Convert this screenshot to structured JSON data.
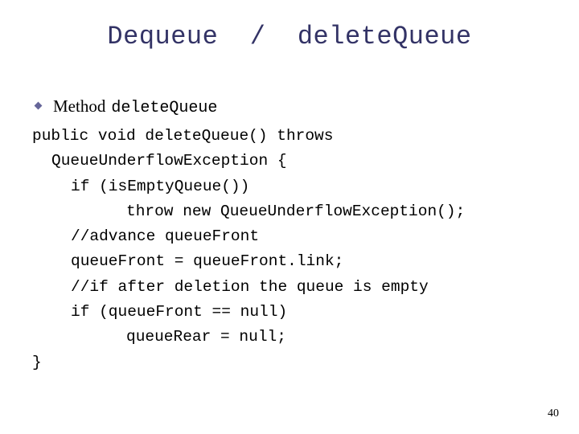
{
  "slide": {
    "title": "Dequeue  /  deleteQueue",
    "page_number": "40",
    "bullet": {
      "icon": "diamond-bullet-icon",
      "serif_text": "Method",
      "mono_text": "deleteQueue"
    },
    "code": {
      "lines": [
        {
          "indent": 0,
          "text": "public void deleteQueue() throws"
        },
        {
          "indent": 1,
          "text": "QueueUnderflowException {"
        },
        {
          "indent": 2,
          "text": "if (isEmptyQueue())"
        },
        {
          "indent": 3,
          "text": "throw new QueueUnderflowException();"
        },
        {
          "indent": 2,
          "text": "//advance queueFront"
        },
        {
          "indent": 2,
          "text": "queueFront = queueFront.link;"
        },
        {
          "indent": 2,
          "text": "//if after deletion the queue is empty"
        },
        {
          "indent": 2,
          "text": "if (queueFront == null)"
        },
        {
          "indent": 3,
          "text": "queueRear = null;"
        },
        {
          "indent": 0,
          "text": "}"
        }
      ]
    },
    "colors": {
      "title": "#333366",
      "bullet": "#666699",
      "body_text": "#000000",
      "background": "#ffffff"
    }
  }
}
